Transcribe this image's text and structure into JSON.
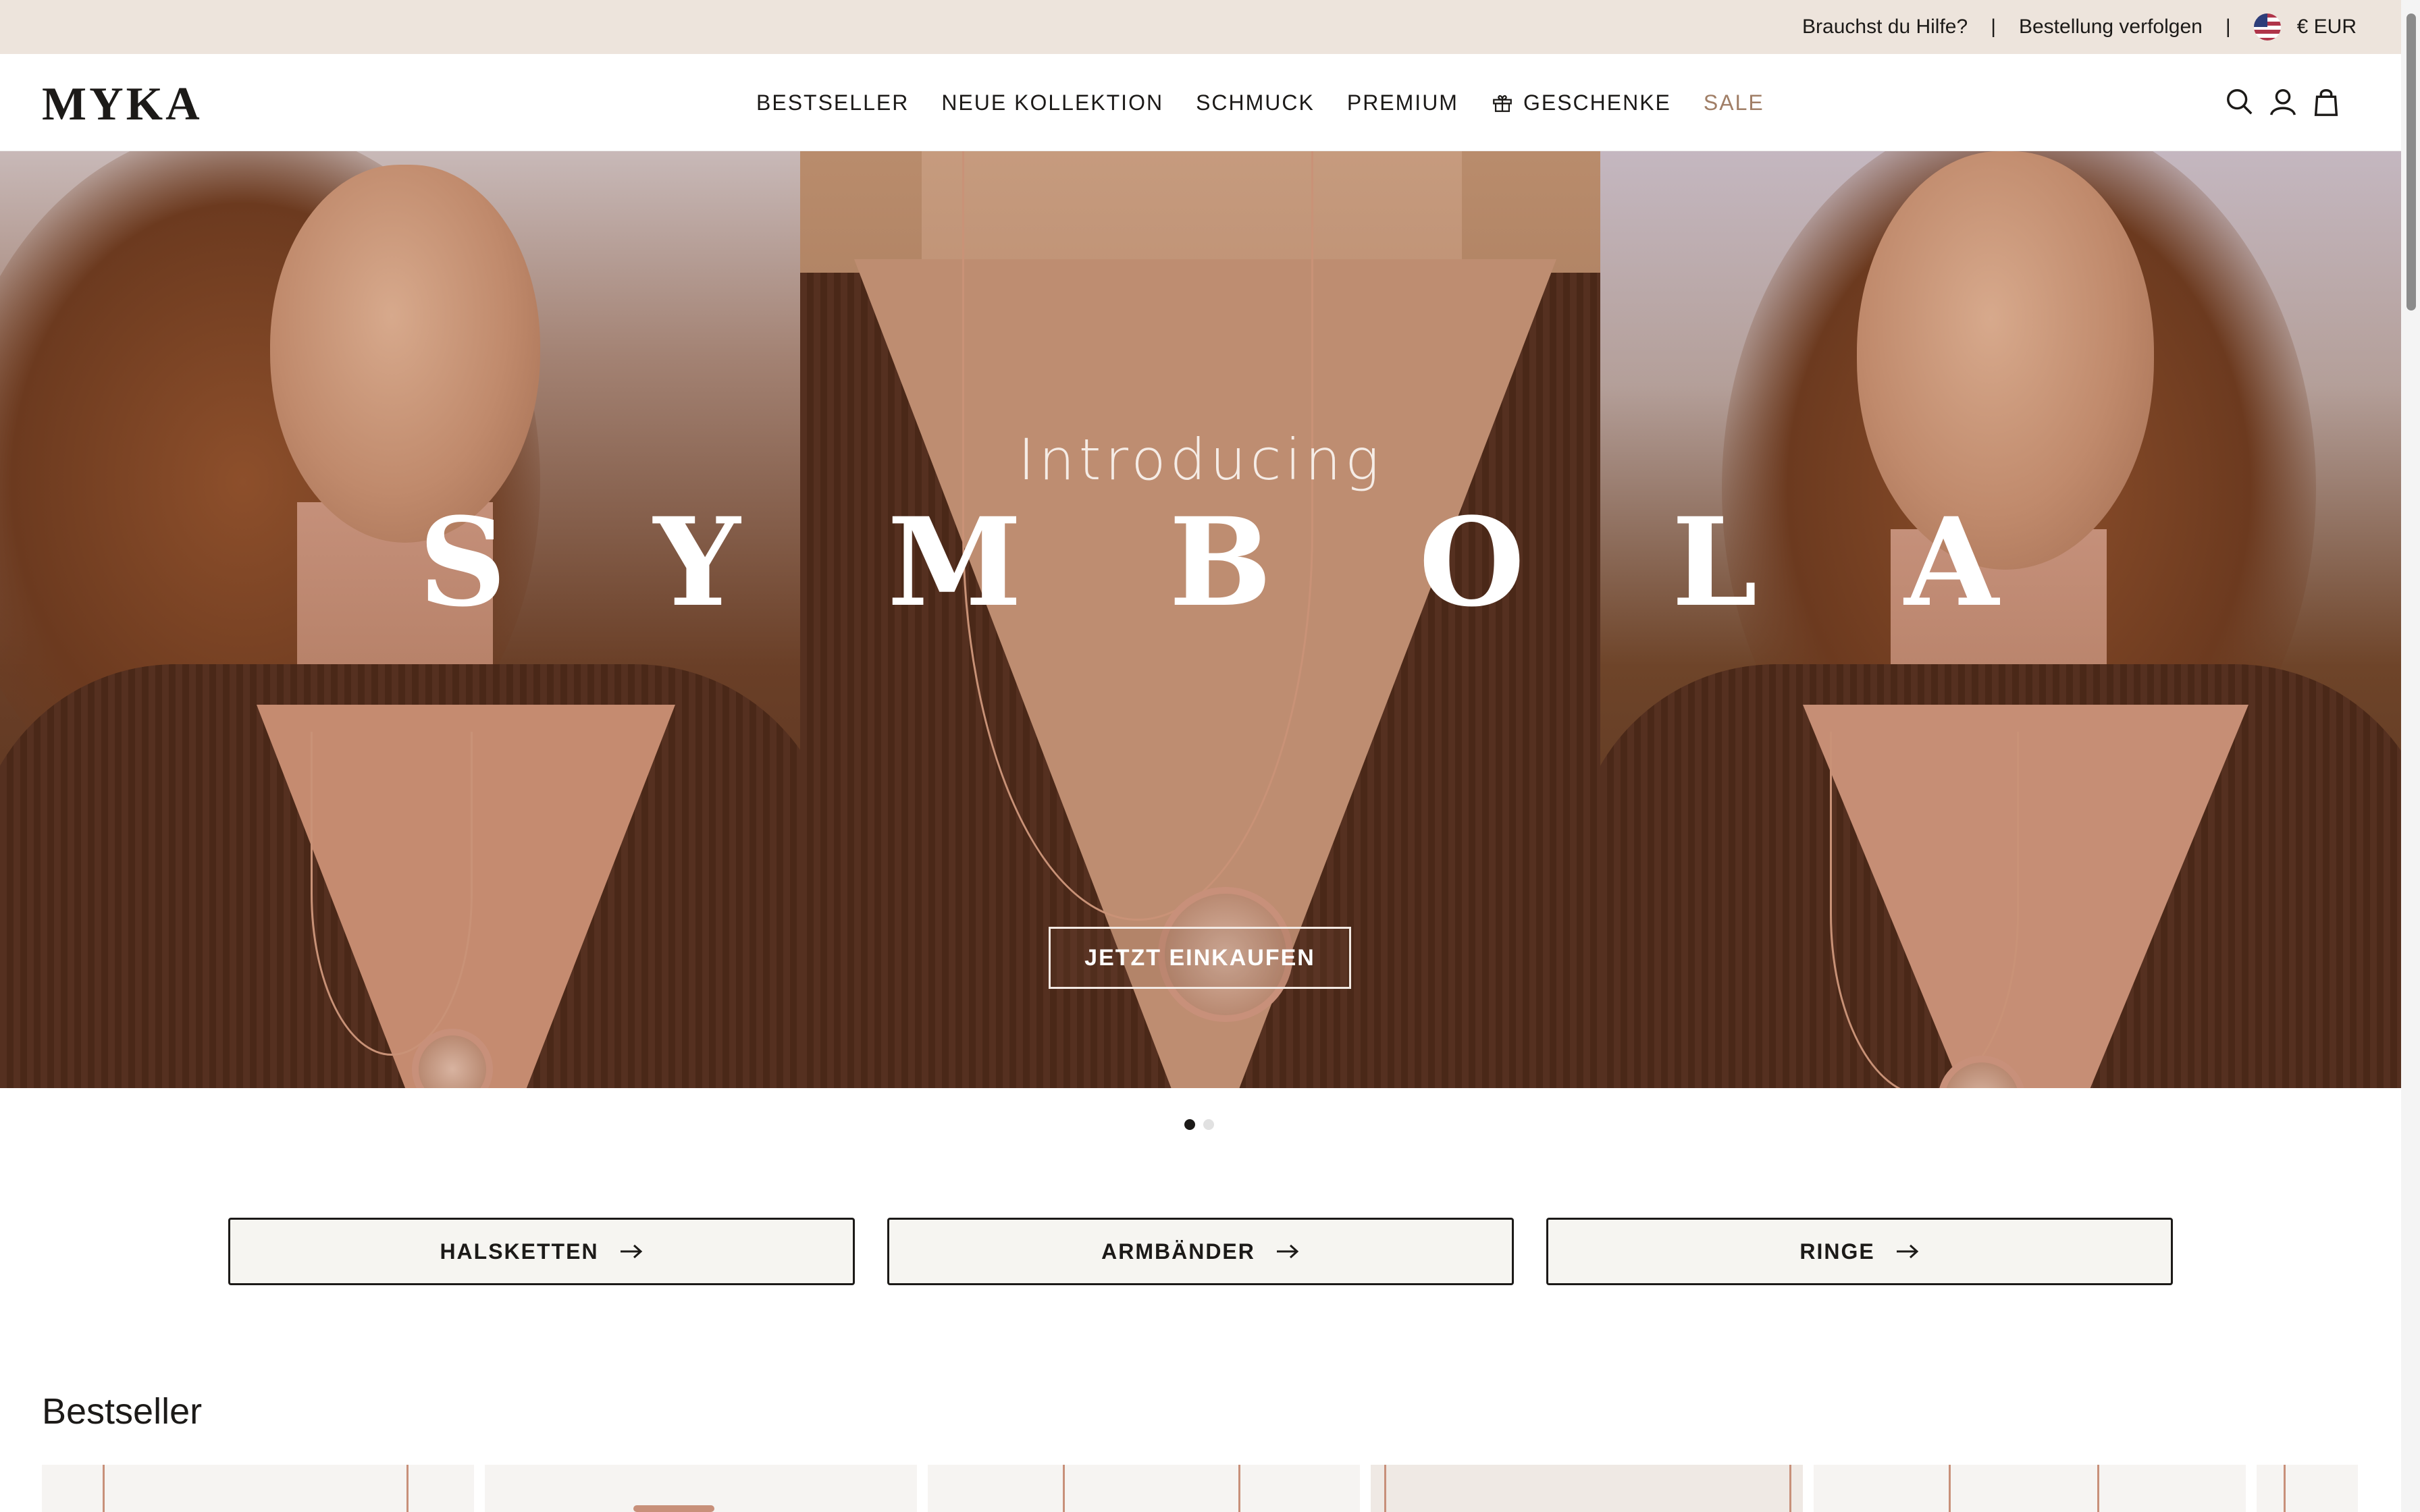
{
  "topbar": {
    "help_label": "Brauchst du Hilfe?",
    "separator": "|",
    "track_label": "Bestellung verfolgen",
    "currency_label": "€ EUR"
  },
  "header": {
    "logo": "MYKA",
    "nav": [
      {
        "label": "BESTSELLER"
      },
      {
        "label": "NEUE KOLLEKTION"
      },
      {
        "label": "SCHMUCK"
      },
      {
        "label": "PREMIUM"
      },
      {
        "label": "GESCHENKE",
        "icon": "gift-icon"
      },
      {
        "label": "SALE"
      }
    ],
    "icons": [
      "search-icon",
      "account-icon",
      "cart-icon"
    ]
  },
  "hero": {
    "intro": "Introducing",
    "letters": [
      "S",
      "Y",
      "M",
      "B",
      "O",
      "L",
      "A"
    ],
    "cta_label": "JETZT EINKAUFEN",
    "slides_count": 2,
    "active_slide": 1
  },
  "categories": [
    {
      "label": "HALSKETTEN"
    },
    {
      "label": "ARMBÄNDER"
    },
    {
      "label": "RINGE"
    }
  ],
  "bestseller": {
    "title": "Bestseller"
  },
  "colors": {
    "topbar_bg": "#ede4dc",
    "sale": "#a07e66",
    "text": "#1c1a18"
  }
}
